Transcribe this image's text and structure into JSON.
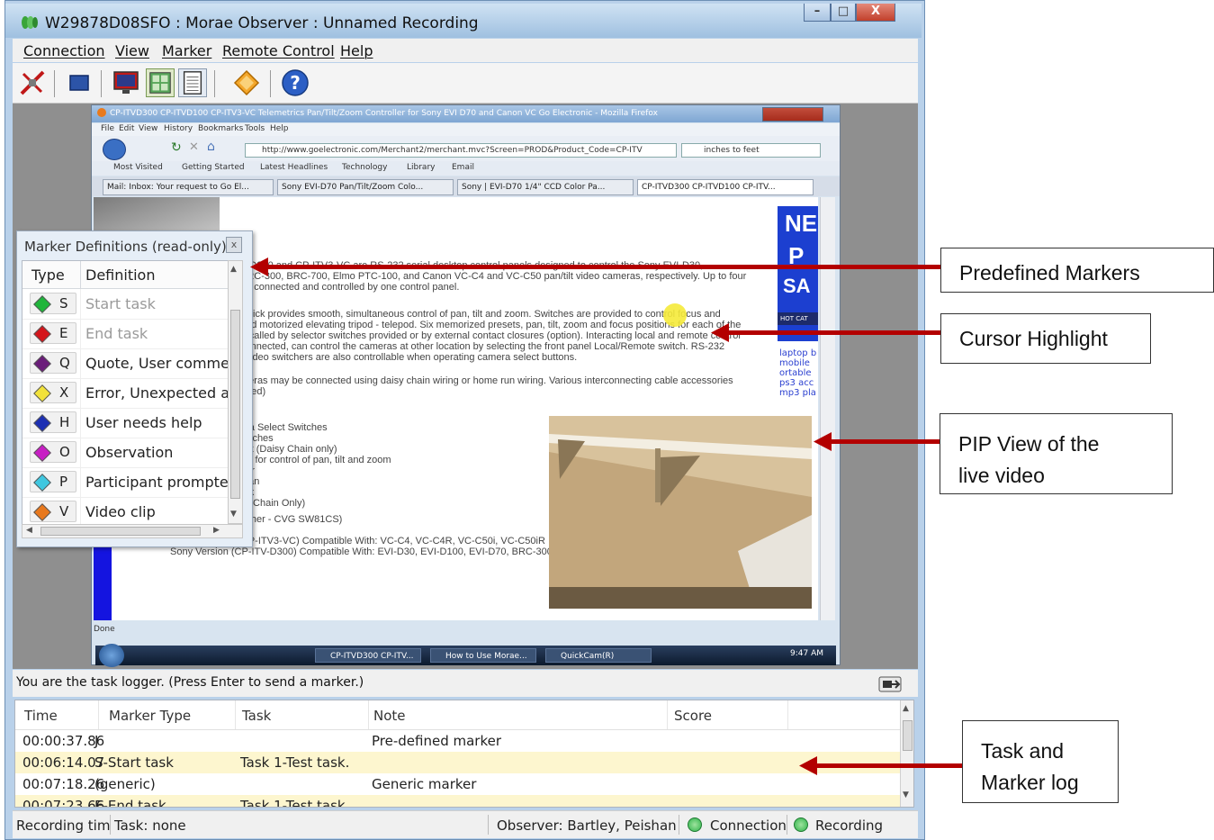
{
  "window": {
    "title": "W29878D08SFO : Morae Observer : Unnamed Recording",
    "controls": {
      "minimize": "–",
      "maximize": "□",
      "close": "X"
    }
  },
  "menubar": [
    "Connection",
    "View",
    "Marker",
    "Remote Control",
    "Help"
  ],
  "toolbar": {
    "icons": [
      "disconnect-icon",
      "stop-icon",
      "screen-view-icon",
      "pip-view-icon",
      "log-view-icon",
      "marker-icon",
      "help-icon"
    ]
  },
  "firefox": {
    "title": "CP-ITVD300 CP-ITVD100 CP-ITV3-VC Telemetrics Pan/Tilt/Zoom Controller for Sony EVI D70 and Canon VC Go Electronic - Mozilla Firefox",
    "menu": [
      "File",
      "Edit",
      "View",
      "History",
      "Bookmarks",
      "Tools",
      "Help"
    ],
    "url": "http://www.goelectronic.com/Merchant2/merchant.mvc?Screen=PROD&Product_Code=CP-ITV",
    "search": "inches to feet",
    "bookmarks": [
      "Most Visited",
      "Getting Started",
      "Latest Headlines",
      "Technology",
      "Library",
      "Email"
    ],
    "tabs": [
      "Mail: Inbox: Your request to Go El...",
      "Sony EVI-D70 Pan/Tilt/Zoom Colo...",
      "Sony | EVI-D70 1/4\" CCD Color Pa...",
      "CP-ITVD300 CP-ITVD100 CP-ITV..."
    ],
    "page_lines": [
      "V-D300 and CP-ITV3-VC are RS-232 serial desktop control panels designed to control the Sony EVI-D30,",
      "BRC-300, BRC-700, Elmo PTC-100, and Canon VC-C4 and VC-C50 pan/tilt video cameras, respectively. Up to four",
      "be connected and controlled by one control panel.",
      "ystick provides smooth, simultaneous control of pan, tilt and zoom. Switches are provided to control focus and",
      "and motorized elevating tripod - telepod. Six memorized presets, pan, tilt, zoom and focus positions for each of the",
      "recalled by selector switches provided or by external contact closures (option). Interacting local and remote control",
      "connected, can control the cameras at other location by selecting the front panel Local/Remote switch. RS-232",
      "l video switchers are also controllable when operating camera select buttons.",
      "meras may be connected using daisy chain wiring or home run wiring. Various interconnecting cable accessories",
      "uded)",
      "era Select Switches",
      "witches",
      "ect (Daisy Chain only)",
      "ick for control of pan, tilt and zoom",
      "our",
      "Man",
      "ark",
      "sy Chain Only)",
      "(Kramer 8x1 Switcher - CVG SW81CS)",
      "Canon Version (CP-ITV3-VC) Compatible With: VC-C4, VC-C4R, VC-C50i, VC-C50iR",
      "Sony Version (CP-ITV-D300) Compatible With: EVI-D30, EVI-D100, EVI-D70, BRC-300, EVI"
    ],
    "side_ad": [
      "NE",
      "P",
      "SA",
      "HOT CAT",
      "laptop b",
      "mobile",
      "ortable",
      "ps3 acc",
      "mp3 pla"
    ],
    "status": "Done"
  },
  "taskbar": {
    "tasks": [
      "CP-ITVD300 CP-ITV...",
      "How to Use Morae...",
      "QuickCam(R)"
    ],
    "clock": "9:47 AM"
  },
  "marker_definitions": {
    "title": "Marker Definitions (read-only)",
    "close": "x",
    "columns": [
      "Type",
      "Definition"
    ],
    "rows": [
      {
        "key": "S",
        "definition": "Start task",
        "color": "#1fb53a",
        "dim": true
      },
      {
        "key": "E",
        "definition": "End task",
        "color": "#d4151b",
        "dim": true
      },
      {
        "key": "Q",
        "definition": "Quote, User comment",
        "color": "#6b1d7a",
        "dim": false
      },
      {
        "key": "X",
        "definition": "Error, Unexpected acti",
        "color": "#f2e23a",
        "dim": false
      },
      {
        "key": "H",
        "definition": "User needs help",
        "color": "#1c2fb3",
        "dim": false
      },
      {
        "key": "O",
        "definition": "Observation",
        "color": "#c81ec4",
        "dim": false
      },
      {
        "key": "P",
        "definition": "Participant prompted",
        "color": "#3fc7e0",
        "dim": false
      },
      {
        "key": "V",
        "definition": "Video clip",
        "color": "#e8781c",
        "dim": false
      }
    ]
  },
  "logger": {
    "prompt": "You are the task logger.  (Press Enter to send a marker.)",
    "columns": [
      "Time",
      "Marker Type",
      "Task",
      "Note",
      "Score"
    ],
    "rows": [
      {
        "time": "00:00:37.86",
        "type": "J",
        "task": "",
        "note": "Pre-defined marker",
        "score": "",
        "highlight": false
      },
      {
        "time": "00:06:14.07",
        "type": "S-Start task",
        "task": "Task 1-Test task.",
        "note": "",
        "score": "",
        "highlight": true
      },
      {
        "time": "00:07:18.26",
        "type": "(generic)",
        "task": "",
        "note": "Generic marker",
        "score": "",
        "highlight": false
      },
      {
        "time": "00:07:23.66",
        "type": "E-End task",
        "task": "Task 1-Test task.",
        "note": "",
        "score": "",
        "highlight": true
      }
    ]
  },
  "statusbar": {
    "recording_time": "Recording tim",
    "task": "Task: none",
    "observer": "Observer: Bartley, Peishan",
    "connection": "Connection",
    "recording": "Recording"
  },
  "annotations": [
    "Predefined Markers",
    "Cursor Highlight",
    "PIP View of the\nlive video",
    "Task and\nMarker log"
  ],
  "colors": {
    "arrow": "#b30000",
    "status_ok": "#2fb34a",
    "cursor_highlight": "#f5ea3a"
  }
}
